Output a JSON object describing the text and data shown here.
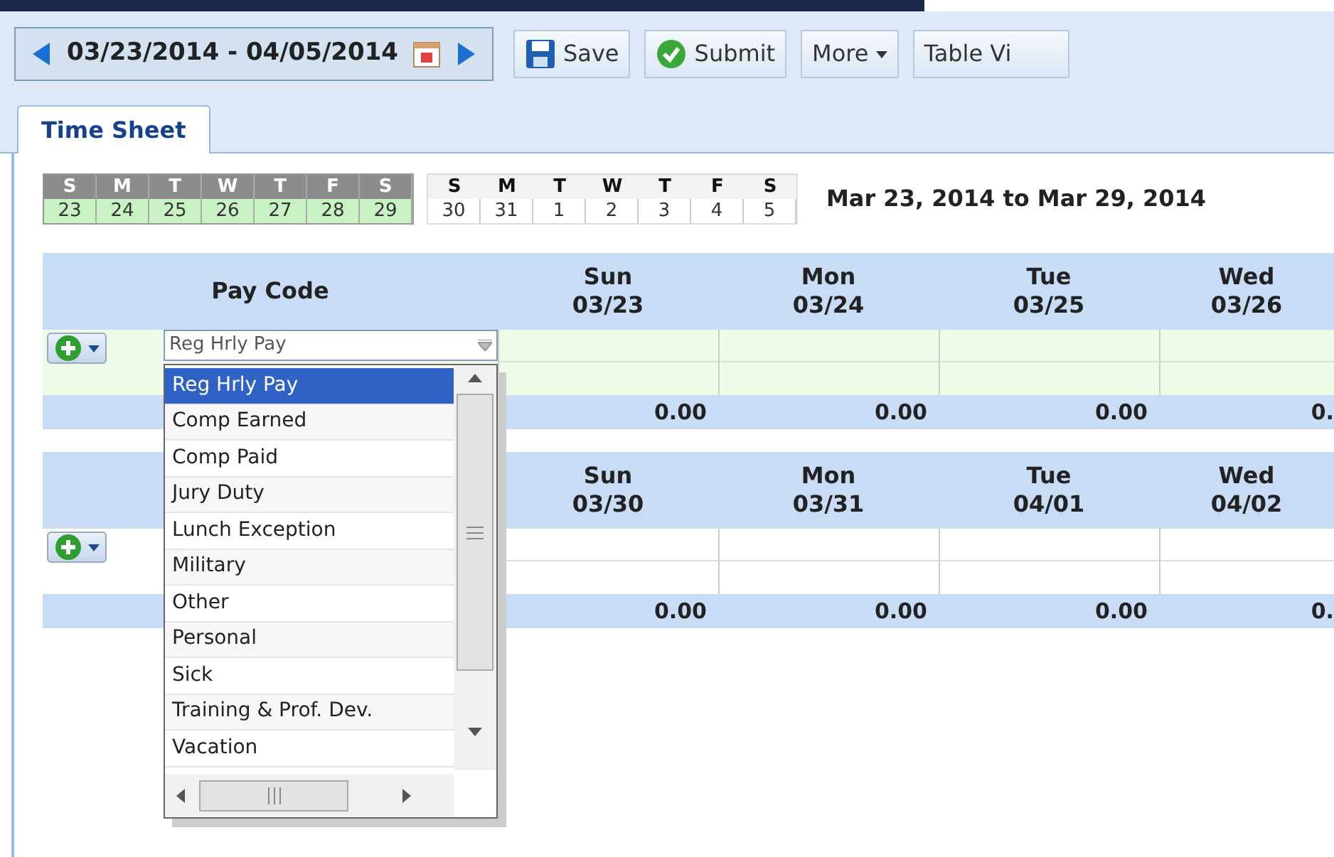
{
  "toolbar": {
    "date_range": "03/23/2014 - 04/05/2014",
    "buttons": [
      {
        "label": "Save",
        "kind": "save"
      },
      {
        "label": "Submit",
        "kind": "submit"
      },
      {
        "label": "More",
        "kind": "menu"
      },
      {
        "label": "Table Vi",
        "kind": "plain"
      }
    ]
  },
  "tabs": [
    {
      "label": "Time Sheet",
      "selected": true
    }
  ],
  "mini_calendar": {
    "weeks": [
      {
        "selected": true,
        "days": [
          {
            "letter": "S",
            "date": "23"
          },
          {
            "letter": "M",
            "date": "24"
          },
          {
            "letter": "T",
            "date": "25"
          },
          {
            "letter": "W",
            "date": "26"
          },
          {
            "letter": "T",
            "date": "27"
          },
          {
            "letter": "F",
            "date": "28"
          },
          {
            "letter": "S",
            "date": "29"
          }
        ]
      },
      {
        "selected": false,
        "days": [
          {
            "letter": "S",
            "date": "30"
          },
          {
            "letter": "M",
            "date": "31"
          },
          {
            "letter": "T",
            "date": "1"
          },
          {
            "letter": "W",
            "date": "2"
          },
          {
            "letter": "T",
            "date": "3"
          },
          {
            "letter": "F",
            "date": "4"
          },
          {
            "letter": "S",
            "date": "5"
          }
        ]
      }
    ],
    "range_label": "Mar 23, 2014 to Mar 29, 2014"
  },
  "weeks": [
    {
      "selected": true,
      "pay_code_heading": "Pay Code",
      "days": [
        {
          "name": "Sun",
          "date": "03/23",
          "total": "0.00"
        },
        {
          "name": "Mon",
          "date": "03/24",
          "total": "0.00"
        },
        {
          "name": "Tue",
          "date": "03/25",
          "total": "0.00"
        },
        {
          "name": "Wed",
          "date": "03/26",
          "total": "0."
        }
      ]
    },
    {
      "selected": false,
      "days": [
        {
          "name": "Sun",
          "date": "03/30",
          "total": "0.00"
        },
        {
          "name": "Mon",
          "date": "03/31",
          "total": "0.00"
        },
        {
          "name": "Tue",
          "date": "04/01",
          "total": "0.00"
        },
        {
          "name": "Wed",
          "date": "04/02",
          "total": "0."
        }
      ]
    }
  ],
  "pay_code_field": {
    "value": "Reg Hrly Pay"
  },
  "pay_code_options": [
    {
      "label": "Reg Hrly Pay",
      "selected": true
    },
    {
      "label": "Comp Earned",
      "selected": false
    },
    {
      "label": "Comp Paid",
      "selected": false
    },
    {
      "label": "Jury Duty",
      "selected": false
    },
    {
      "label": "Lunch Exception",
      "selected": false
    },
    {
      "label": "Military",
      "selected": false
    },
    {
      "label": "Other",
      "selected": false
    },
    {
      "label": "Personal",
      "selected": false
    },
    {
      "label": "Sick",
      "selected": false
    },
    {
      "label": "Training & Prof. Dev.",
      "selected": false
    },
    {
      "label": "Vacation",
      "selected": false
    }
  ]
}
